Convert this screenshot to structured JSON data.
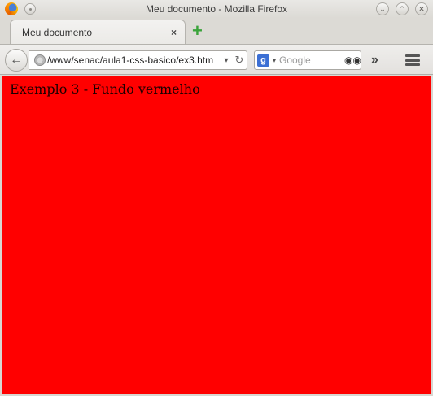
{
  "window": {
    "title": "Meu documento - Mozilla Firefox"
  },
  "tabs": [
    {
      "label": "Meu documento",
      "close": "×"
    }
  ],
  "newtab": {
    "label": "+"
  },
  "nav": {
    "back_label": "←",
    "url": "/www/senac/aula1-css-basico/ex3.htm",
    "url_drop": "▾",
    "reload": "↻",
    "search_engine": "g",
    "search_placeholder": "Google",
    "engine_drop": "▾",
    "overflow": "»"
  },
  "page": {
    "text": "Exemplo 3 - Fundo vermelho",
    "background": "#ff0000"
  }
}
